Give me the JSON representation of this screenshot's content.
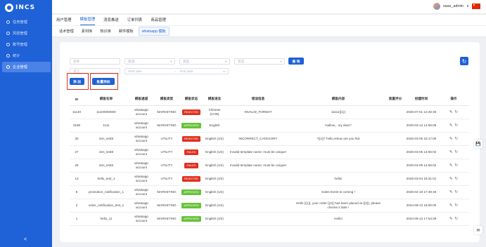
{
  "app": {
    "logo_text": "INCS"
  },
  "sidebar": {
    "items": [
      {
        "label": "任务管理",
        "icon": "task-icon"
      },
      {
        "label": "风控管理",
        "icon": "shield-icon"
      },
      {
        "label": "账号管理",
        "icon": "account-icon"
      },
      {
        "label": "统计",
        "icon": "chart-icon"
      },
      {
        "label": "企业管理",
        "icon": "enterprise-icon",
        "active": true
      }
    ],
    "collapse_label": "<"
  },
  "topbar": {
    "username": "saas_admin",
    "caret": "∨"
  },
  "tabs_main": [
    "用户管理",
    "模板管理",
    "消息推送",
    "订单列表",
    "商品管理"
  ],
  "tabs_sub": [
    "话术管理",
    "素材库",
    "知识库",
    "邮件模板",
    "whatsapp 模板"
  ],
  "filters": {
    "f1": "名称",
    "f2": "渠道",
    "f3": "类型",
    "f4": "状态",
    "f5": "语言",
    "query_button": "查 询",
    "f6": "质量评分",
    "start_date": "Start date",
    "arrow": "→",
    "end_date": "End date"
  },
  "actions": {
    "add": "添 加",
    "batch_add": "批量添加"
  },
  "table": {
    "headers": [
      "ID",
      "模板名称",
      "模板通道",
      "模板类型",
      "模板状态",
      "模板语言",
      "错误信息",
      "模板内容",
      "质量评分",
      "创建时间",
      "操作"
    ],
    "rows": [
      {
        "id": "11140",
        "name": "11100000000",
        "channel": "whatsapp account",
        "type": "MARKETING",
        "status": "REJECTED",
        "language": "Chinese (CHN)",
        "error": "INVALID_FORMAT",
        "content": "11111{{1}}",
        "score": "",
        "created": "2025-07-01 12:26:45"
      },
      {
        "id": "3188",
        "name": "1111",
        "channel": "whatsapp account",
        "type": "MARKETING",
        "status": "APPROVED",
        "language": "English",
        "error": "",
        "content": "Hallow，my dear?",
        "score": "",
        "created": "2025-03-12 14:56:06"
      },
      {
        "id": "30",
        "name": "2en_test9",
        "channel": "whatsapp account",
        "type": "UTILITY",
        "status": "REJECTED",
        "language": "English (US)",
        "error": "INCORRECT_CATEGORY",
        "content": "*{{1}}* hello,!show are you hiiii",
        "score": "",
        "created": "2025-03-05 15:17:00"
      },
      {
        "id": "27",
        "name": "2en_test8",
        "channel": "whatsapp account",
        "type": "UTILITY",
        "status": "FAILED",
        "language": "English (US)",
        "error": "Invalid template name: must be unique!",
        "content": "",
        "score": "",
        "created": "2025-03-05 14:56:02"
      },
      {
        "id": "26",
        "name": "2en_test5",
        "channel": "whatsapp account",
        "type": "UTILITY",
        "status": "FAILED",
        "language": "English (US)",
        "error": "Invalid template name: must be unique!",
        "content": "",
        "score": "",
        "created": "2025-03-05 14:56:02"
      },
      {
        "id": "13",
        "name": "hello_test_1",
        "channel": "whatsapp account",
        "type": "UTILITY",
        "status": "REJECTED",
        "language": "English (US)",
        "error": "",
        "content": "hello!",
        "score": "",
        "created": "2025-03-04 19:31:01"
      },
      {
        "id": "5",
        "name": "promotion_notification_1",
        "channel": "whatsapp account",
        "type": "MARKETING",
        "status": "APPROVED",
        "language": "English (US)",
        "error": "",
        "content": "Sales Event is coming !",
        "score": "",
        "created": "2025-02-19 17:39:46"
      },
      {
        "id": "2",
        "name": "order_notification_test_1",
        "channel": "whatsapp account",
        "type": "MARKETING",
        "status": "APPROVED",
        "language": "English (US)",
        "error": "",
        "content": "Hello {{1}}, your order {{2}} has been placed at {{3}}, please checke it later !",
        "score": "",
        "created": "2024-08-13 18:00:00"
      },
      {
        "id": "1",
        "name": "hello_11",
        "channel": "whatsapp account",
        "type": "MARKETING",
        "status": "APPROVED",
        "language": "English (US)",
        "error": "",
        "content": "Hello!",
        "score": "",
        "created": "2024-08-13 17:54:39"
      }
    ],
    "ops_edit": "✎",
    "ops_refresh": "↻"
  },
  "colors": {
    "primary": "#1f61d6",
    "rejected": "#e0301e",
    "failed": "#e0301e",
    "approved": "#67c23a",
    "highlight": "#e0301e"
  },
  "float": {
    "top": "💾",
    "bottom": "✉"
  }
}
